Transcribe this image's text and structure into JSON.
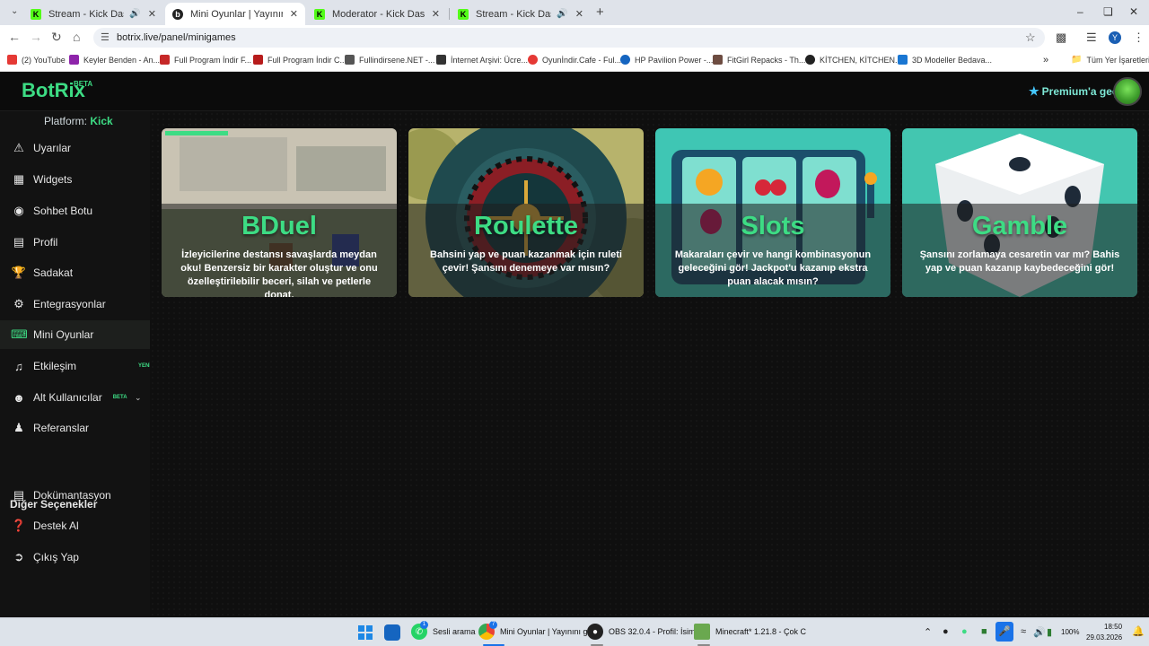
{
  "browser": {
    "tabs": [
      {
        "title": "Stream - Kick Dashboard",
        "active": false,
        "audio": true
      },
      {
        "title": "Mini Oyunlar | Yayınını güçlendi",
        "active": true,
        "audio": false
      },
      {
        "title": "Moderator - Kick Dashboard",
        "active": false,
        "audio": false
      },
      {
        "title": "Stream - Kick Dashboard",
        "active": false,
        "audio": true
      }
    ],
    "url": "botrix.live/panel/minigames",
    "avatar_letter": "Y",
    "bookmarks": [
      {
        "label": "(2) YouTube",
        "color": "#e53935"
      },
      {
        "label": "Keyler Benden - An...",
        "color": "#8e24aa"
      },
      {
        "label": "Full Program İndir F...",
        "color": "#c62828"
      },
      {
        "label": "Full Program İndir C...",
        "color": "#b71c1c"
      },
      {
        "label": "Fullindirsene.NET -...",
        "color": "#555555"
      },
      {
        "label": "İnternet Arşivi: Ücre...",
        "color": "#333333"
      },
      {
        "label": "Oyunİndir.Cafe - Ful...",
        "color": "#e53935"
      },
      {
        "label": "HP Pavilion Power -...",
        "color": "#1565c0"
      },
      {
        "label": "FitGirl Repacks - Th...",
        "color": "#6d4c41"
      },
      {
        "label": "KİTCHEN, KİTCHEN...",
        "color": "#222222"
      },
      {
        "label": "3D Modeller Bedava...",
        "color": "#1976d2"
      }
    ],
    "all_bookmarks": "Tüm Yer İşaretleri"
  },
  "header": {
    "logo": "BotRix",
    "logo_badge": "BETA",
    "premium": "Premium'a geç"
  },
  "sidebar": {
    "platform_label": "Platform:",
    "platform_value": "Kick",
    "items": [
      {
        "label": "Uyarılar",
        "icon": "warning-icon"
      },
      {
        "label": "Widgets",
        "icon": "widgets-icon"
      },
      {
        "label": "Sohbet Botu",
        "icon": "robot-icon"
      },
      {
        "label": "Profil",
        "icon": "profile-card-icon"
      },
      {
        "label": "Sadakat",
        "icon": "trophy-icon"
      },
      {
        "label": "Entegrasyonlar",
        "icon": "integrations-icon"
      },
      {
        "label": "Mini Oyunlar",
        "icon": "gamepad-icon",
        "active": true
      },
      {
        "label": "Etkileşim",
        "icon": "music-note-icon",
        "badge": "YENİ"
      },
      {
        "label": "Alt Kullanıcılar",
        "icon": "users-icon",
        "badge": "BETA"
      },
      {
        "label": "Referanslar",
        "icon": "referrals-icon"
      }
    ],
    "other_title": "Diğer Seçenekler",
    "other_items": [
      {
        "label": "Dokümantasyon",
        "icon": "docs-icon"
      },
      {
        "label": "Destek Al",
        "icon": "help-icon"
      },
      {
        "label": "Çıkış Yap",
        "icon": "logout-icon"
      }
    ]
  },
  "games": [
    {
      "title": "BDuel",
      "description": "İzleyicilerine destansı savaşlarda meydan oku! Benzersiz bir karakter oluştur ve onu özelleştirilebilir beceri, silah ve petlerle donat."
    },
    {
      "title": "Roulette",
      "description": "Bahsini yap ve puan kazanmak için ruleti çevir! Şansını denemeye var mısın?"
    },
    {
      "title": "Slots",
      "description": "Makaraları çevir ve hangi kombinasyonun geleceğini gör! Jackpot'u kazanıp ekstra puan alacak mısın?"
    },
    {
      "title": "Gamble",
      "description": "Şansını zorlamaya cesaretin var mı? Bahis yap ve puan kazanıp kaybedeceğini gör!"
    }
  ],
  "taskbar": {
    "items": [
      {
        "label": "Sesli arama"
      },
      {
        "label": "Mini Oyunlar | Yayınını g"
      },
      {
        "label": "OBS 32.0.4 - Profil: İsim:"
      },
      {
        "label": "Minecraft* 1.21.8 - Çok C"
      }
    ],
    "battery": "100%",
    "time": "18:50",
    "date": "29.03.2026",
    "whatsapp_badge": "1",
    "chrome_badge": "7"
  }
}
